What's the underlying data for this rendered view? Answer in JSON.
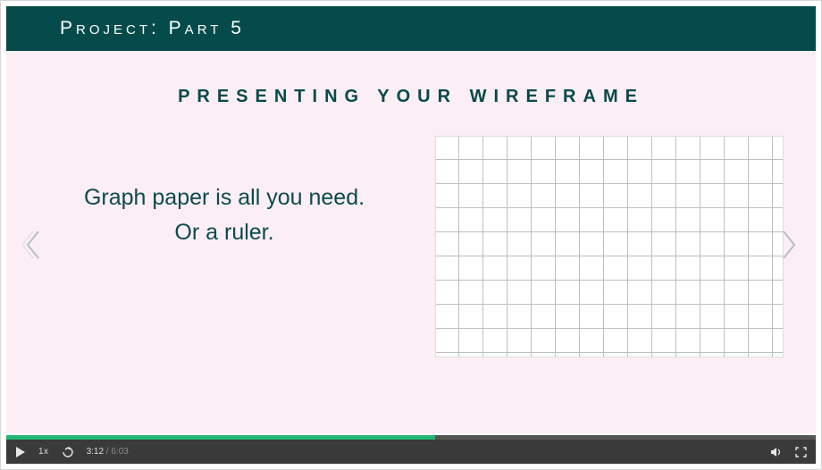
{
  "header": {
    "title": "Project: Part 5"
  },
  "subtitle": "Presenting Your Wireframe",
  "body": {
    "line1": "Graph paper is all you need.",
    "line2": "Or a ruler."
  },
  "player": {
    "speed_label": "1x",
    "current_time": "3:12",
    "duration": "6:03",
    "separator": " / ",
    "progress_pct": 53
  },
  "colors": {
    "header_bg": "#064b4c",
    "slide_bg": "#fbeef4",
    "accent": "#22b573"
  }
}
